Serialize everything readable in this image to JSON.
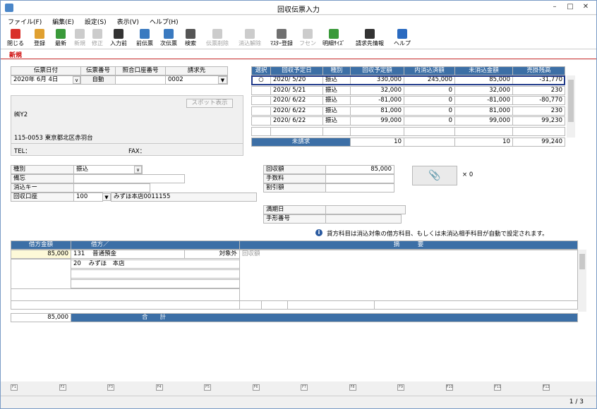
{
  "window": {
    "title": "回収伝票入力"
  },
  "menu": [
    "ファイル(F)",
    "編集(E)",
    "設定(S)",
    "表示(V)",
    "ヘルプ(H)"
  ],
  "toolbar": [
    {
      "label": "閉じる",
      "icon": "close-icon",
      "color": "#d9302a",
      "enabled": true
    },
    {
      "label": "登録",
      "icon": "register-icon",
      "color": "#e0a030",
      "enabled": true
    },
    {
      "label": "最新",
      "icon": "refresh-icon",
      "color": "#3a9a3a",
      "enabled": true
    },
    {
      "label": "新規",
      "icon": "new-icon",
      "color": "#cccccc",
      "enabled": false
    },
    {
      "label": "修正",
      "icon": "edit-icon",
      "color": "#cccccc",
      "enabled": false
    },
    {
      "label": "入力前",
      "icon": "undo-icon",
      "color": "#333333",
      "enabled": true
    },
    {
      "label": "前伝票",
      "icon": "prev-slip-icon",
      "color": "#3a7ac0",
      "enabled": true
    },
    {
      "label": "次伝票",
      "icon": "next-slip-icon",
      "color": "#3a7ac0",
      "enabled": true
    },
    {
      "label": "検索",
      "icon": "search-icon",
      "color": "#555555",
      "enabled": true
    },
    {
      "label": "伝票削除",
      "icon": "delete-icon",
      "color": "#cccccc",
      "enabled": false
    },
    {
      "label": "消込解除",
      "icon": "unreconcile-icon",
      "color": "#cccccc",
      "enabled": false
    },
    {
      "label": "ﾏｽﾀｰ登録",
      "icon": "master-icon",
      "color": "#707070",
      "enabled": true
    },
    {
      "label": "フセン",
      "icon": "sticky-icon",
      "color": "#cccccc",
      "enabled": false
    },
    {
      "label": "明細ｻｲｽﾞ",
      "icon": "detail-size-icon",
      "color": "#3a9a3a",
      "enabled": true
    },
    {
      "label": "請求先情報",
      "icon": "customer-info-icon",
      "color": "#333333",
      "enabled": true
    },
    {
      "label": "ヘルプ",
      "icon": "help-icon",
      "color": "#2a6ac0",
      "enabled": true
    }
  ],
  "tab": "新規",
  "header": {
    "col_date": "伝票日付",
    "col_no": "伝票番号",
    "col_account": "照合口座番号",
    "col_customer": "請求先",
    "date": "2020年 6月 4日",
    "no": "自動",
    "account": "",
    "customer": "0002"
  },
  "spot_button": "スポット表示",
  "customer_info": {
    "name": "㈱Y2",
    "address": "115-0053 東京都北区赤羽台",
    "tel_label": "TEL：",
    "fax_label": "FAX："
  },
  "grid": {
    "columns": [
      "選択",
      "回収予定日",
      "種別",
      "回収予定額",
      "内消込済額",
      "未消込金額",
      "売掛残高"
    ],
    "rows": [
      [
        "○",
        "2020/ 5/20",
        "振込",
        "330,000",
        "245,000",
        "85,000",
        "-31,770"
      ],
      [
        "",
        "2020/ 5/21",
        "振込",
        "32,000",
        "0",
        "32,000",
        "230"
      ],
      [
        "",
        "2020/ 6/22",
        "振込",
        "-81,000",
        "0",
        "-81,000",
        "-80,770"
      ],
      [
        "",
        "2020/ 6/22",
        "振込",
        "81,000",
        "0",
        "81,000",
        "230"
      ],
      [
        "",
        "2020/ 6/22",
        "振込",
        "99,000",
        "0",
        "99,000",
        "99,230"
      ]
    ],
    "footer": {
      "label": "未請求",
      "v1": "10",
      "v2": "10",
      "v3": "99,240"
    }
  },
  "form": {
    "type_label": "種別",
    "type_value": "振込",
    "memo_label": "備忘",
    "memo_value": "",
    "key_label": "消込キー",
    "key_value": "",
    "account_label": "回収口座",
    "account_code": "100",
    "account_name": "みずほ本店0011155"
  },
  "amounts": {
    "collect_label": "回収額",
    "collect_value": "85,000",
    "fee_label": "手数料",
    "fee_value": "",
    "discount_label": "割引額",
    "discount_value": ""
  },
  "maturity": {
    "date_label": "満期日",
    "date_value": "",
    "note_label": "手形番号",
    "note_value": ""
  },
  "attach": {
    "count": "× 0"
  },
  "info_message": "貸方科目は消込対象の借方科目、もしくは未消込相手科目が自動で設定されます。",
  "journal": {
    "col_amount": "借方金額",
    "col_debit": "借方／",
    "col_summary": "摘　　　要",
    "amount": "85,000",
    "code1": "131",
    "name1": "普通預金",
    "target": "対象外",
    "code2": "20",
    "name2": "みずほ　本店",
    "summary": "回収額",
    "total_amount": "85,000",
    "total_label": "合　　計"
  },
  "fkeys": [
    "F1",
    "F2",
    "F3",
    "F4",
    "F5",
    "F6",
    "F7",
    "F8",
    "F9",
    "F10",
    "F11",
    "F12"
  ],
  "status": {
    "page": "1 / 3"
  }
}
